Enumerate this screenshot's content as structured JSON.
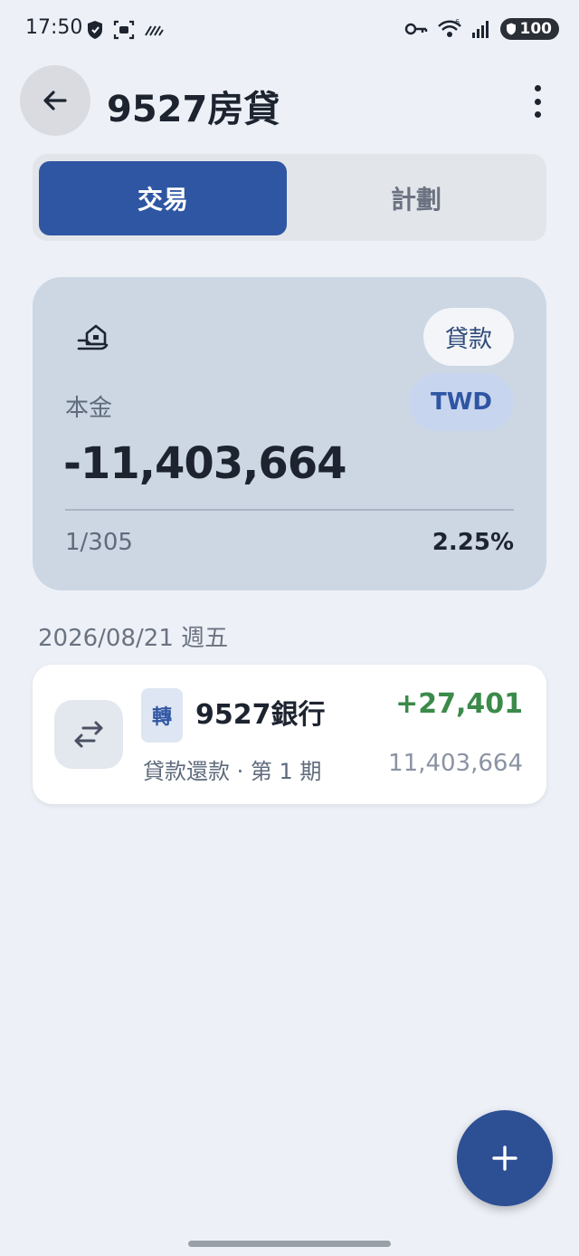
{
  "status_bar": {
    "time": "17:50",
    "left_icons": [
      "shield-icon",
      "screenshot-icon",
      "signal-lines-icon"
    ],
    "right_icons": [
      "key-icon",
      "wifi-icon",
      "cell-signal-icon"
    ],
    "wifi_badge": "6",
    "battery": "100"
  },
  "header": {
    "title": "9527房貸",
    "back_icon": "arrow-left-icon",
    "more_icon": "more-vertical-icon"
  },
  "tabs": {
    "active": "交易",
    "inactive": "計劃"
  },
  "summary": {
    "icon": "house-hand-icon",
    "type_chip": "貸款",
    "currency_chip": "TWD",
    "principal_label": "本金",
    "principal_value": "-11,403,664",
    "progress": "1/305",
    "rate": "2.25%"
  },
  "transactions": {
    "date_header": "2026/08/21 週五",
    "items": [
      {
        "icon": "transfer-arrows-icon",
        "type_badge": "轉",
        "name": "9527銀行",
        "description": "貸款還款 · 第 1 期",
        "amount": "+27,401",
        "balance": "11,403,664"
      }
    ]
  },
  "fab": {
    "icon": "plus-icon"
  },
  "colors": {
    "primary": "#2f56a3",
    "positive": "#3b8a4a",
    "background": "#edf1f7",
    "card": "#cdd7e4"
  }
}
